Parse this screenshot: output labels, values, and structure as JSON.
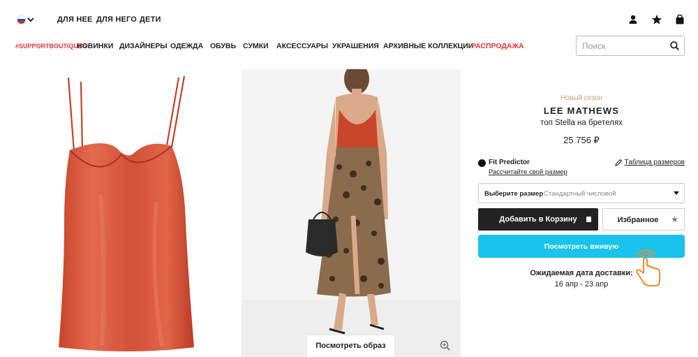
{
  "header": {
    "region_flag": "russia-flag",
    "gender_tabs": [
      "ДЛЯ НЕЕ",
      "ДЛЯ НЕГО",
      "ДЕТИ"
    ],
    "icons": [
      "account-icon",
      "star-icon",
      "shopping-bag-icon"
    ]
  },
  "nav": {
    "items": [
      "#SUPPORTBOUTIQUES",
      "НОВИНКИ",
      "ДИЗАЙНЕРЫ",
      "ОДЕЖДА",
      "ОБУВЬ",
      "СУМКИ",
      "АКСЕССУАРЫ",
      "УКРАШЕНИЯ",
      "АРХИВНЫЕ КОЛЛЕКЦИИ",
      "РАСПРОДАЖА"
    ],
    "accent_color": "#e8323c"
  },
  "search": {
    "placeholder": "Поиск",
    "value": ""
  },
  "gallery": {
    "look_button": "Посмотреть образ",
    "zoom_icon": "zoom-in-icon"
  },
  "product": {
    "season": "Новый сезон",
    "brand": "LEE MATHEWS",
    "name": "топ Stella на бретелях",
    "price": "25 756 ₽"
  },
  "fit_predictor": {
    "title": "Fit Predictor",
    "link": "Рассчитайте свой размер",
    "size_chart": "Таблица размеров"
  },
  "size_select": {
    "label": "Выберите размер",
    "value": "Стандартный числовой"
  },
  "actions": {
    "add_to_cart": "Добавить в Корзину",
    "favorite": "Избранное",
    "watch_live": "Посмотреть вживую",
    "watch_live_color": "#19c3ec"
  },
  "delivery": {
    "label": "Ожидаемая дата доставки:",
    "dates": "16 апр - 23 апр"
  }
}
